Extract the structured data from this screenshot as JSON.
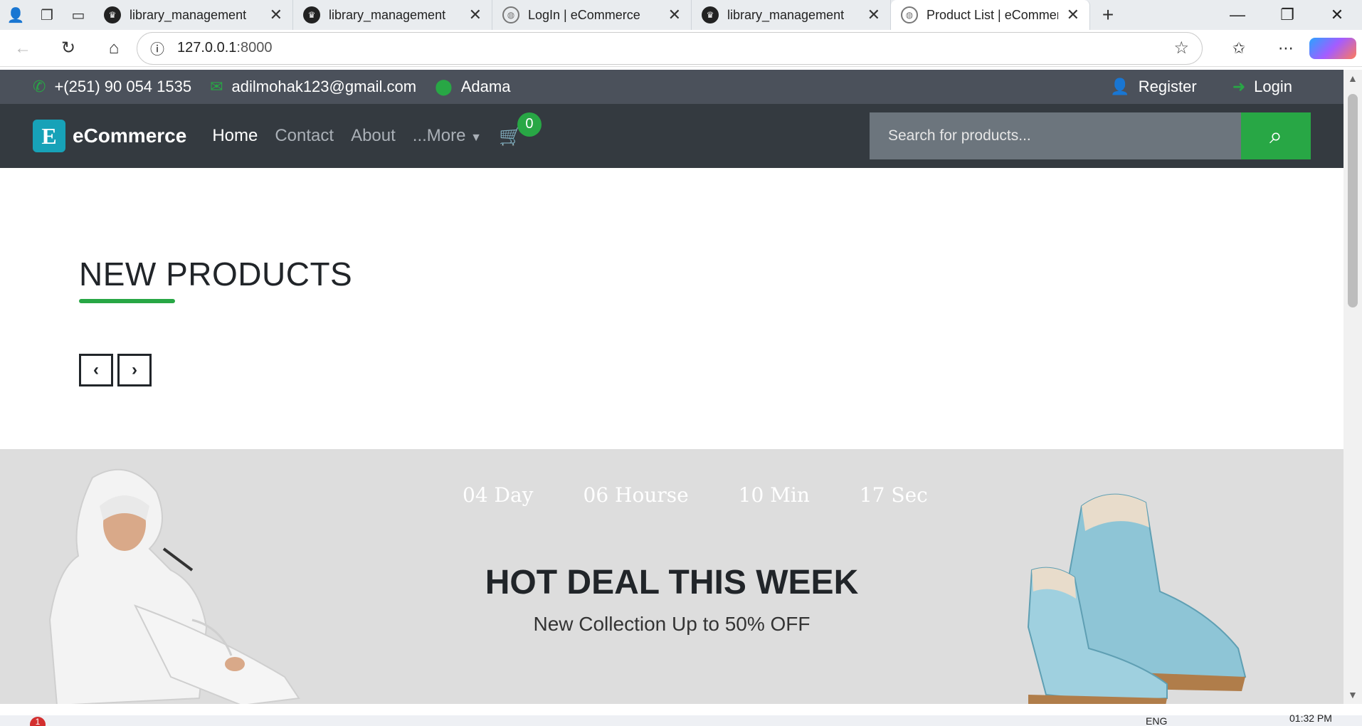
{
  "browser": {
    "tabs": [
      {
        "title": "library_management",
        "favicon": "crown-favicon"
      },
      {
        "title": "library_management",
        "favicon": "crown-favicon"
      },
      {
        "title": "LogIn | eCommerce",
        "favicon": "globe-favicon"
      },
      {
        "title": "library_management",
        "favicon": "crown-favicon"
      },
      {
        "title": "Product List | eCommerce",
        "favicon": "globe-favicon",
        "active": true
      }
    ],
    "url_host": "127.0.0.1",
    "url_port": ":8000"
  },
  "topbar": {
    "phone": "+(251) 90 054 1535",
    "email": "adilmohak123@gmail.com",
    "location": "Adama",
    "register": "Register",
    "login": "Login"
  },
  "navbar": {
    "brand_letter": "E",
    "brand": "eCommerce",
    "links": [
      "Home",
      "Contact",
      "About",
      "...More"
    ],
    "cart_count": "0",
    "search_placeholder": "Search for products..."
  },
  "new_products": {
    "title": "NEW PRODUCTS",
    "prev": "‹",
    "next": "›"
  },
  "hot_deal": {
    "countdown": [
      "04 Day",
      "06 Hourse",
      "10 Min",
      "17 Sec"
    ],
    "title": "HOT DEAL THIS WEEK",
    "subtitle": "New Collection Up to 50% OFF"
  },
  "taskbar": {
    "notification_count": "1",
    "language": "ENG",
    "time": "01:32 PM"
  },
  "colors": {
    "accent": "#28a745",
    "topbar_bg": "#4b515b",
    "navbar_bg": "#343a40",
    "brand_logo": "#17a2b8",
    "deal_bg": "#dddddd"
  }
}
